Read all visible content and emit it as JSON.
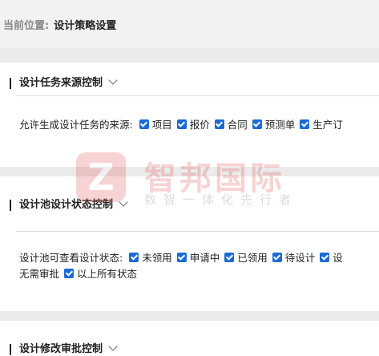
{
  "breadcrumb": {
    "prefix": "当前位置:",
    "current": "设计策略设置"
  },
  "sections": {
    "source": {
      "title": "设计任务来源控制",
      "label": "允许生成设计任务的来源:",
      "options": [
        "项目",
        "报价",
        "合同",
        "预测单",
        "生产订"
      ]
    },
    "pool": {
      "title": "设计池设计状态控制",
      "label": "设计池可查看设计状态:",
      "options_row1": [
        "未领用",
        "申请中",
        "已领用",
        "待设计",
        "设"
      ],
      "options_row2_text": "无需审批",
      "options_row2": [
        "以上所有状态"
      ]
    },
    "modify": {
      "title": "设计修改审批控制"
    }
  },
  "watermark": {
    "logo_letter": "Z",
    "name": "智邦国际",
    "slogan": "数智一体化先行者"
  },
  "colors": {
    "checkbox": "#1b6bd6",
    "panel": "#ffffff",
    "background": "#ebebeb"
  }
}
